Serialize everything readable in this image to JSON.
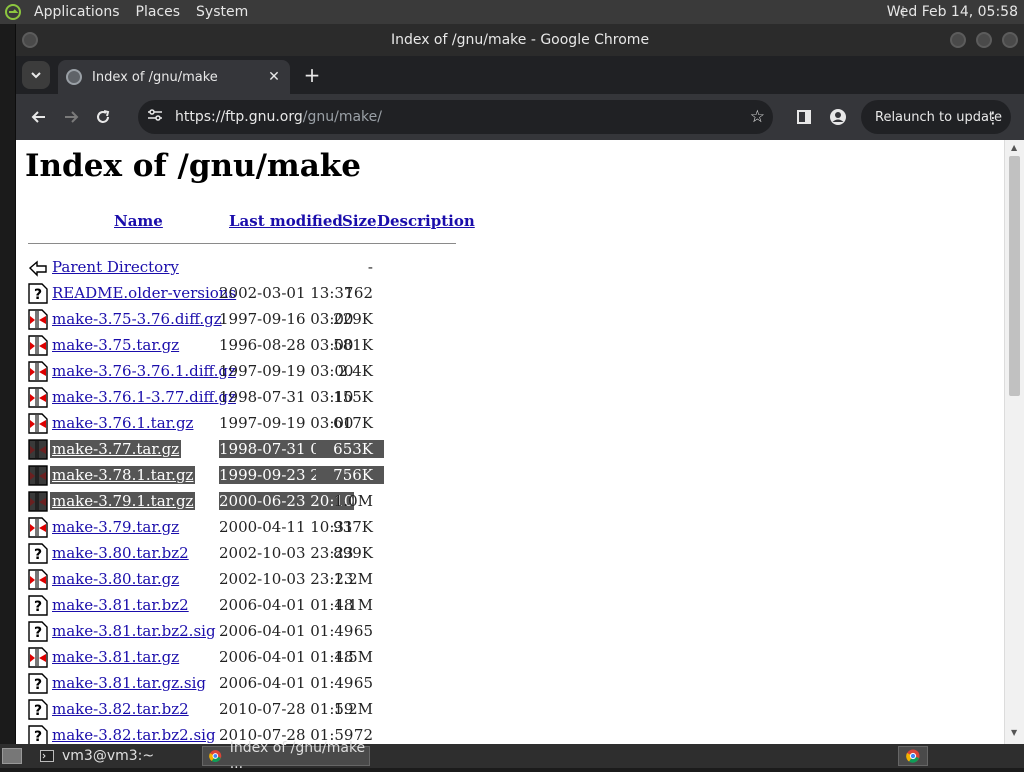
{
  "panel": {
    "menus": [
      "Applications",
      "Places",
      "System"
    ],
    "clock": "Wed Feb 14, 05:58"
  },
  "window": {
    "title": "Index of /gnu/make - Google Chrome"
  },
  "tab": {
    "title": "Index of /gnu/make",
    "close": "✕",
    "new_tab": "+"
  },
  "omnibox": {
    "url_scheme_host": "https://ftp.gnu.org",
    "url_path": "/gnu/make/"
  },
  "toolbar": {
    "relaunch_label": "Relaunch to update"
  },
  "page": {
    "heading": "Index of /gnu/make",
    "columns": {
      "name": "Name",
      "last_modified": "Last modified",
      "size": "Size",
      "description": "Description"
    },
    "rows": [
      {
        "name": "Parent Directory",
        "date": "",
        "size": "-",
        "icon": "back-icon",
        "selected": false
      },
      {
        "name": "README.older-versions",
        "date": "2002-03-01 13:37",
        "size": "162",
        "icon": "unknown-file-icon",
        "selected": false
      },
      {
        "name": "make-3.75-3.76.diff.gz",
        "date": "1997-09-16 03:00",
        "size": "229K",
        "icon": "compressed-file-icon",
        "selected": false
      },
      {
        "name": "make-3.75.tar.gz",
        "date": "1996-08-28 03:00",
        "size": "581K",
        "icon": "compressed-file-icon",
        "selected": false
      },
      {
        "name": "make-3.76-3.76.1.diff.gz",
        "date": "1997-09-19 03:00",
        "size": "2.4K",
        "icon": "compressed-file-icon",
        "selected": false
      },
      {
        "name": "make-3.76.1-3.77.diff.gz",
        "date": "1998-07-31 03:10",
        "size": "155K",
        "icon": "compressed-file-icon",
        "selected": false
      },
      {
        "name": "make-3.76.1.tar.gz",
        "date": "1997-09-19 03:00",
        "size": "617K",
        "icon": "compressed-file-icon",
        "selected": false
      },
      {
        "name": "make-3.77.tar.gz",
        "date": "1998-07-31 03:09",
        "size": "653K",
        "icon": "compressed-file-icon",
        "selected": true
      },
      {
        "name": "make-3.78.1.tar.gz",
        "date": "1999-09-23 20:33",
        "size": "756K",
        "icon": "compressed-file-icon",
        "selected": true
      },
      {
        "name": "make-3.79.1.tar.gz",
        "date": "2000-06-23 20:10",
        "size": "1.0M",
        "icon": "compressed-file-icon",
        "selected": true
      },
      {
        "name": "make-3.79.tar.gz",
        "date": "2000-04-11 10:31",
        "size": "937K",
        "icon": "compressed-file-icon",
        "selected": false
      },
      {
        "name": "make-3.80.tar.bz2",
        "date": "2002-10-03 23:23",
        "size": "899K",
        "icon": "unknown-file-icon",
        "selected": false
      },
      {
        "name": "make-3.80.tar.gz",
        "date": "2002-10-03 23:23",
        "size": "1.2M",
        "icon": "compressed-file-icon",
        "selected": false
      },
      {
        "name": "make-3.81.tar.bz2",
        "date": "2006-04-01 01:48",
        "size": "1.1M",
        "icon": "unknown-file-icon",
        "selected": false
      },
      {
        "name": "make-3.81.tar.bz2.sig",
        "date": "2006-04-01 01:49",
        "size": "65",
        "icon": "unknown-file-icon",
        "selected": false
      },
      {
        "name": "make-3.81.tar.gz",
        "date": "2006-04-01 01:48",
        "size": "1.5M",
        "icon": "compressed-file-icon",
        "selected": false
      },
      {
        "name": "make-3.81.tar.gz.sig",
        "date": "2006-04-01 01:49",
        "size": "65",
        "icon": "unknown-file-icon",
        "selected": false
      },
      {
        "name": "make-3.82.tar.bz2",
        "date": "2010-07-28 01:59",
        "size": "1.2M",
        "icon": "unknown-file-icon",
        "selected": false
      },
      {
        "name": "make-3.82.tar.bz2.sig",
        "date": "2010-07-28 01:59",
        "size": "72",
        "icon": "unknown-file-icon",
        "selected": false
      }
    ]
  },
  "taskbar": {
    "items": [
      "vm3@vm3:~",
      "Index of /gnu/make ..."
    ]
  },
  "colors": {
    "link": "#1a0dab",
    "selection": "#555555",
    "chrome_dark": "#35363a"
  }
}
